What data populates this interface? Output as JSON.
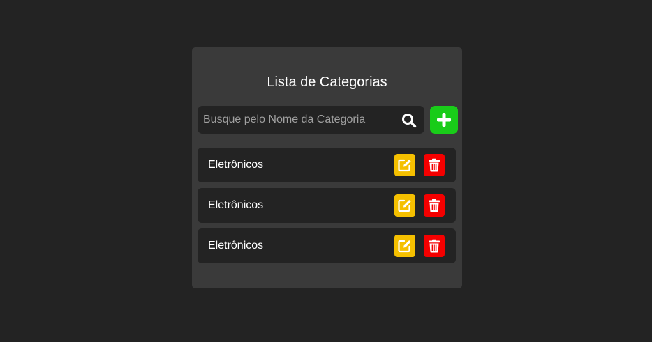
{
  "title": "Lista de Categorias",
  "search": {
    "placeholder": "Busque pelo Nome da Categoria",
    "value": "",
    "icon": "search-icon"
  },
  "add_button": {
    "icon": "plus-icon",
    "color": "#19cc19"
  },
  "categories": [
    {
      "name": "Eletrônicos"
    },
    {
      "name": "Eletrônicos"
    },
    {
      "name": "Eletrônicos"
    }
  ],
  "item_actions": {
    "edit": {
      "icon": "edit-icon",
      "color": "#f5c000"
    },
    "delete": {
      "icon": "trash-icon",
      "color": "#f50000"
    }
  },
  "colors": {
    "background": "#232323",
    "card": "#3a3a3a"
  }
}
